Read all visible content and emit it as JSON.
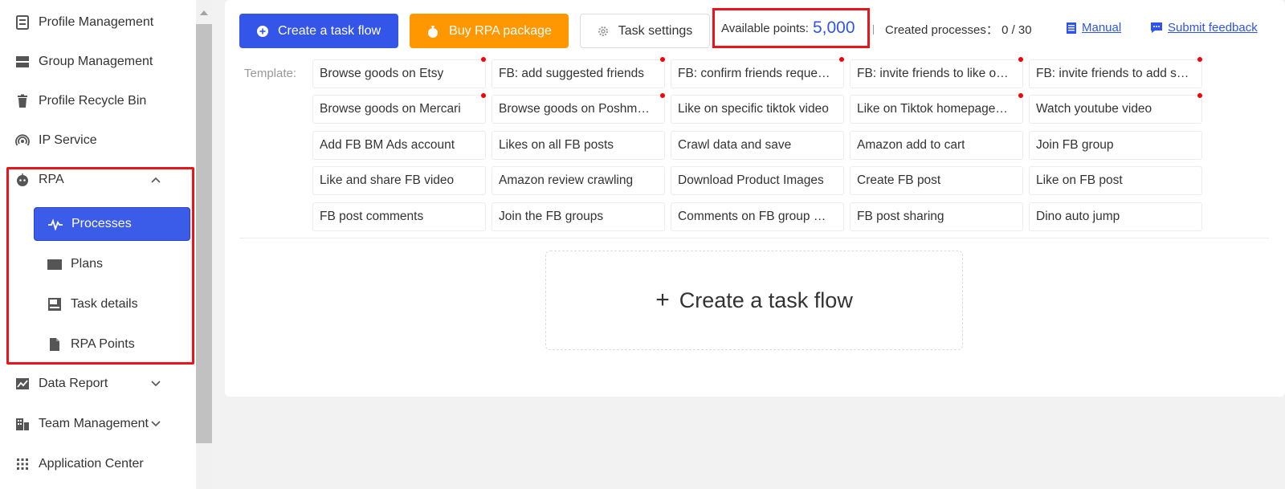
{
  "sidebar": {
    "items": [
      {
        "label": "Profile Management",
        "icon": "profile-icon"
      },
      {
        "label": "Group Management",
        "icon": "group-icon"
      },
      {
        "label": "Profile Recycle Bin",
        "icon": "trash-icon"
      },
      {
        "label": "IP Service",
        "icon": "signal-icon"
      },
      {
        "label": "RPA",
        "icon": "robot-icon"
      },
      {
        "label": "Data Report",
        "icon": "chart-icon"
      },
      {
        "label": "Team Management",
        "icon": "building-icon"
      },
      {
        "label": "Application Center",
        "icon": "grid-icon"
      }
    ],
    "rpa_sub": [
      {
        "label": "Processes",
        "icon": "pulse-icon",
        "active": true
      },
      {
        "label": "Plans",
        "icon": "folder-icon"
      },
      {
        "label": "Task details",
        "icon": "details-icon"
      },
      {
        "label": "RPA Points",
        "icon": "document-icon"
      }
    ]
  },
  "toolbar": {
    "create_label": "Create a task flow",
    "buy_label": "Buy RPA package",
    "settings_label": "Task settings",
    "points_label": "Available points:",
    "points_value": "5,000",
    "created_label": "Created processes： 0 / 30",
    "manual_label": "Manual",
    "feedback_label": "Submit feedback"
  },
  "template": {
    "label": "Template:",
    "items": [
      "Browse goods on Etsy",
      "FB: add suggested friends",
      "FB: confirm friends reque…",
      "FB: invite friends to like o…",
      "FB: invite friends to add s…",
      "Browse goods on Mercari",
      "Browse goods on Poshm…",
      "Like on specific tiktok video",
      "Like on Tiktok homepage…",
      "Watch youtube video",
      "Add FB BM Ads account",
      "Likes on all FB posts",
      "Crawl data and save",
      "Amazon add to cart",
      "Join FB group",
      "Like and share FB video",
      "Amazon review crawling",
      "Download Product Images",
      "Create FB post",
      "Like on FB post",
      "FB post comments",
      "Join the FB groups",
      "Comments on FB group …",
      "FB post sharing",
      "Dino auto jump"
    ]
  },
  "main": {
    "big_create_label": "Create a task flow"
  },
  "colors": {
    "primary": "#3355e8",
    "orange": "#ff9800",
    "highlight": "#e8151b",
    "new_dot": "#f5000a"
  }
}
